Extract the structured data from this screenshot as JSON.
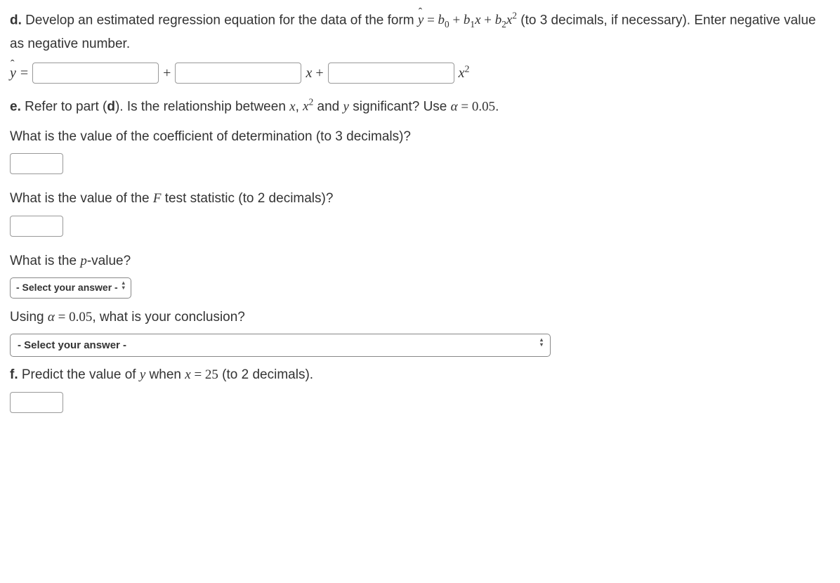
{
  "d": {
    "label": "d.",
    "text_before_eq": " Develop an estimated regression equation for the data of the form ",
    "eq_lhs_y": "y",
    "eq_eq": " = ",
    "eq_rhs_part1": "b",
    "eq_rhs_sub0": "0",
    "eq_rhs_plus1": " + ",
    "eq_rhs_b1": "b",
    "eq_rhs_sub1": "1",
    "eq_rhs_x1": "x",
    "eq_rhs_plus2": " + ",
    "eq_rhs_b2": "b",
    "eq_rhs_sub2": "2",
    "eq_rhs_x2": "x",
    "eq_rhs_sup2": "2",
    "text_after_eq": " (to 3 decimals, if necessary). Enter negative value as negative number."
  },
  "eqline": {
    "yhat": "y",
    "eq": "=",
    "plus1": "+",
    "x1": "x",
    "plus2": " +",
    "x2": "x",
    "sup2": "2"
  },
  "e": {
    "label": "e.",
    "text1": " Refer to part (",
    "bold_d": "d",
    "text2": "). Is the relationship between ",
    "x": "x",
    "comma": ", ",
    "x2": "x",
    "sup2": "2",
    "text3": " and ",
    "y": "y",
    "text4": " significant? Use ",
    "alpha": "α",
    "eq": " = ",
    "alpha_val": "0.05",
    "period": "."
  },
  "q_coef": "What is the value of the coefficient of determination (to 3 decimals)?",
  "q_fstat_pre": "What is the value of the ",
  "q_fstat_F": "F",
  "q_fstat_post": " test statistic (to 2 decimals)?",
  "q_pvalue_pre": "What is the ",
  "q_pvalue_p": "p",
  "q_pvalue_post": "-value?",
  "select_placeholder": "- Select your answer -",
  "q_conclusion_pre": "Using ",
  "q_conclusion_alpha": "α",
  "q_conclusion_eq": " = ",
  "q_conclusion_val": "0.05",
  "q_conclusion_post": ", what is your conclusion?",
  "f": {
    "label": "f.",
    "text1": " Predict the value of ",
    "y": "y",
    "text2": " when ",
    "x": "x",
    "eq": " = ",
    "val": "25",
    "text3": " (to 2 decimals)."
  }
}
